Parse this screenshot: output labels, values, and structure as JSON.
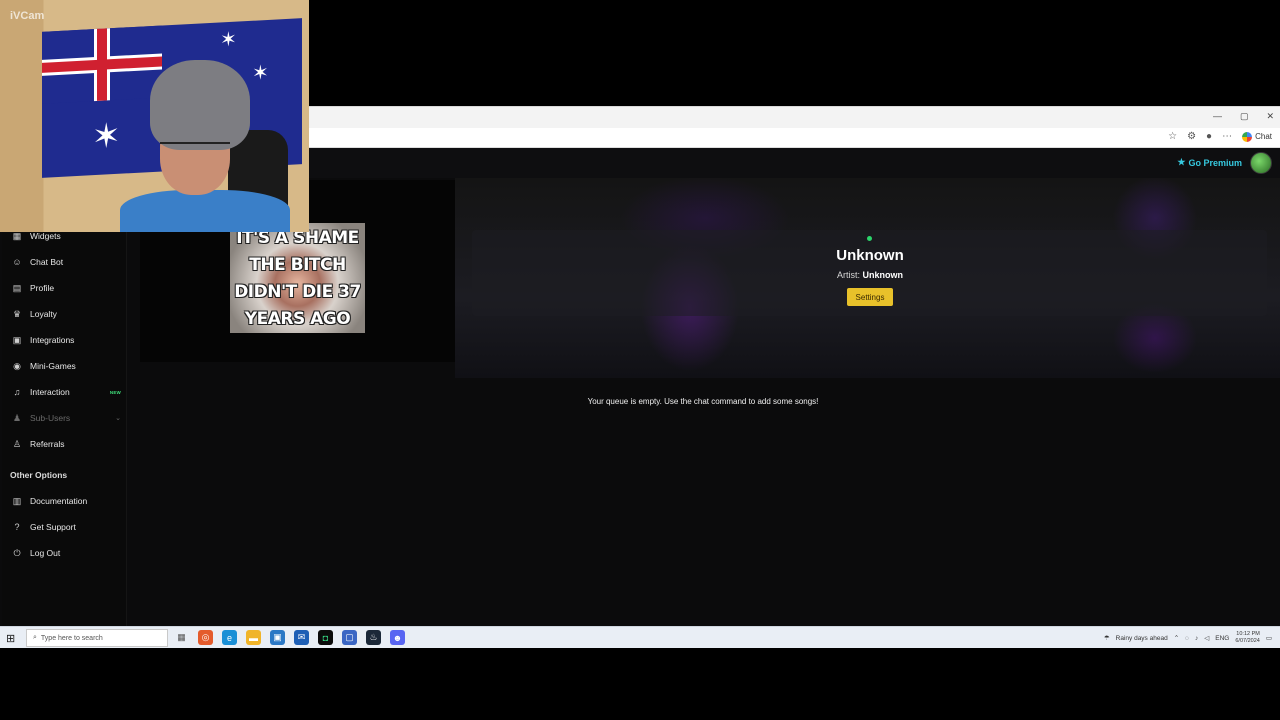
{
  "webcam": {
    "label": "iVCam"
  },
  "browser": {
    "chat_label": "Chat"
  },
  "header": {
    "premium_label": "Go Premium"
  },
  "sidebar": {
    "items": [
      {
        "label": "Widgets",
        "icon": "widgets-icon"
      },
      {
        "label": "Chat Bot",
        "icon": "robot-icon"
      },
      {
        "label": "Profile",
        "icon": "profile-card-icon"
      },
      {
        "label": "Loyalty",
        "icon": "trophy-icon"
      },
      {
        "label": "Integrations",
        "icon": "puzzle-icon"
      },
      {
        "label": "Mini-Games",
        "icon": "gamepad-icon"
      },
      {
        "label": "Interaction",
        "icon": "music-note-icon",
        "badge": "NEW"
      },
      {
        "label": "Sub-Users",
        "icon": "users-icon"
      },
      {
        "label": "Referrals",
        "icon": "referrals-icon"
      }
    ],
    "other_title": "Other Options",
    "other_items": [
      {
        "label": "Documentation",
        "icon": "book-icon"
      },
      {
        "label": "Get Support",
        "icon": "help-icon"
      },
      {
        "label": "Log Out",
        "icon": "logout-icon"
      }
    ]
  },
  "meme": {
    "text": "IT'S A SHAME THE BITCH DIDN'T DIE 37 YEARS AGO"
  },
  "player": {
    "title": "Unknown",
    "artist_label": "Artist:",
    "artist": "Unknown",
    "settings_label": "Settings",
    "queue_message": "Your queue is empty. Use the chat command to add some songs!"
  },
  "taskbar": {
    "search_placeholder": "Type here to search",
    "weather": "Rainy days ahead",
    "language": "ENG",
    "time": "10:12 PM",
    "date": "6/07/2024"
  },
  "colors": {
    "accent_premium": "#36c9e0",
    "settings_button": "#e8c12a",
    "status_dot": "#2bd46a",
    "new_badge": "#3ee07a"
  }
}
